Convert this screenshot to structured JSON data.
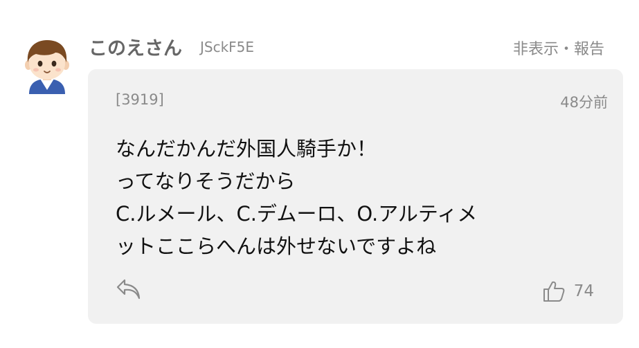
{
  "comment": {
    "username": "このえさん",
    "user_id": "JSckF5E",
    "hide_report_label": "非表示・報告",
    "number": "[3919]",
    "timestamp": "48分前",
    "lines": [
      "なんだかんだ外国人騎手か！",
      "ってなりそうだから",
      "C.ルメール、C.デムーロ、O.アルティメ",
      "ットここらへんは外せないですよね"
    ],
    "like_count": "74"
  },
  "icons": {
    "avatar": "avatar-boy-icon",
    "reply": "reply-arrow-icon",
    "like": "thumbs-up-icon"
  },
  "colors": {
    "bubble_background": "#f1f1f1",
    "secondary_text": "#8a8a8a",
    "username_text": "#666666",
    "body_text": "#111111",
    "avatar_hair": "#7a4a22",
    "avatar_skin": "#fbe3cc",
    "avatar_shirt": "#3a5fb0"
  }
}
